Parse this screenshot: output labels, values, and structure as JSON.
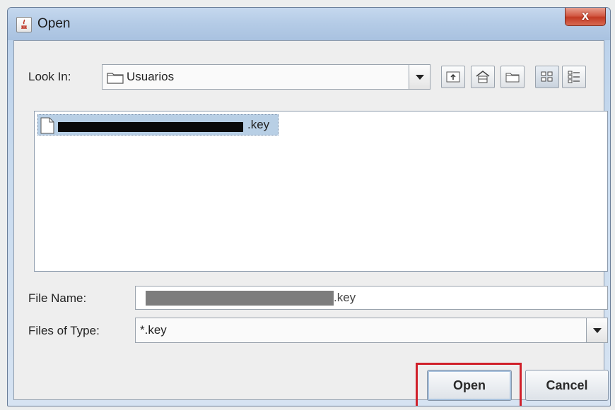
{
  "window": {
    "title": "Open",
    "close_glyph": "x"
  },
  "look_in": {
    "label": "Look In:",
    "value": "Usuarios",
    "icon": "folder-icon"
  },
  "toolbar": {
    "buttons": [
      "up-one-level-icon",
      "home-icon",
      "new-folder-icon",
      "list-view-icon",
      "details-view-icon"
    ]
  },
  "file_list": {
    "items": [
      {
        "name_visible_suffix": ".key",
        "redacted": true,
        "selected": true,
        "icon": "document-icon"
      }
    ]
  },
  "file_name": {
    "label": "File Name:",
    "value_suffix": ".key",
    "redacted": true
  },
  "files_of_type": {
    "label": "Files of Type:",
    "value": "*.key"
  },
  "buttons": {
    "open": "Open",
    "cancel": "Cancel"
  },
  "colors": {
    "selection": "#b8cfe5",
    "highlight_box": "#d0202a",
    "close_button": "#c23a24"
  }
}
